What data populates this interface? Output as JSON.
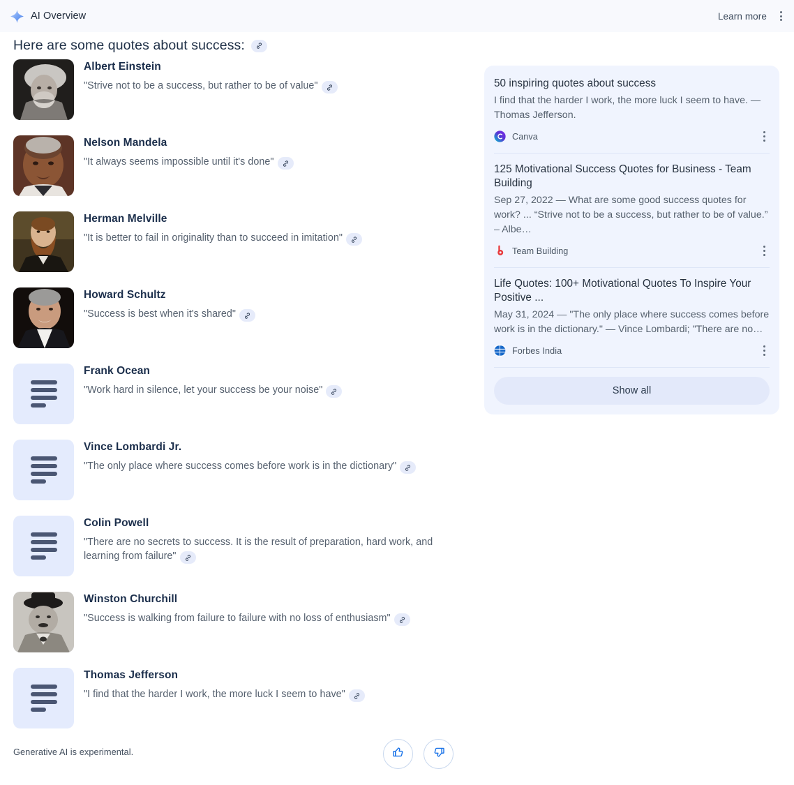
{
  "header": {
    "icon": "sparkle-icon",
    "title": "AI Overview",
    "learn_more": "Learn more",
    "menu_icon": "kebab-menu-icon"
  },
  "main": {
    "intro": "Here are some quotes about success:",
    "intro_link_icon": "link-chip-icon",
    "quotes": [
      {
        "name": "Albert Einstein",
        "quote": "\"Strive not to be a success, but rather to be of value\"",
        "thumb": "photo"
      },
      {
        "name": "Nelson Mandela",
        "quote": "\"It always seems impossible until it's done\"",
        "thumb": "photo"
      },
      {
        "name": "Herman Melville",
        "quote": "\"It is better to fail in originality than to succeed in imitation\"",
        "thumb": "photo"
      },
      {
        "name": "Howard Schultz",
        "quote": "\"Success is best when it's shared\"",
        "thumb": "photo"
      },
      {
        "name": "Frank Ocean",
        "quote": "\"Work hard in silence, let your success be your noise\"",
        "thumb": "placeholder"
      },
      {
        "name": "Vince Lombardi Jr.",
        "quote": "\"The only place where success comes before work is in the dictionary\"",
        "thumb": "placeholder"
      },
      {
        "name": "Colin Powell",
        "quote": "\"There are no secrets to success. It is the result of preparation, hard work, and learning from failure\"",
        "thumb": "placeholder"
      },
      {
        "name": "Winston Churchill",
        "quote": "\"Success is walking from failure to failure with no loss of enthusiasm\"",
        "thumb": "photo"
      },
      {
        "name": "Thomas Jefferson",
        "quote": "\"I find that the harder I work, the more luck I seem to have\"",
        "thumb": "placeholder"
      }
    ]
  },
  "sources": {
    "items": [
      {
        "title": "50 inspiring quotes about success",
        "snippet": "I find that the harder I work, the more luck I seem to have. — Thomas Jefferson.",
        "site": "Canva",
        "favicon": "canva-icon"
      },
      {
        "title": "125 Motivational Success Quotes for Business - Team Building",
        "snippet": "Sep 27, 2022 — What are some good success quotes for work? ... “Strive not to be a success, but rather to be of value.” – Albe…",
        "site": "Team Building",
        "favicon": "teambuilding-icon"
      },
      {
        "title": "Life Quotes: 100+ Motivational Quotes To Inspire Your Positive ...",
        "snippet": "May 31, 2024 — \"The only place where success comes before work is in the dictionary.\" — Vince Lombardi; \"There are no…",
        "site": "Forbes India",
        "favicon": "globe-icon"
      }
    ],
    "show_all": "Show all"
  },
  "footer": {
    "note": "Generative AI is experimental.",
    "thumbs_up_icon": "thumbs-up-icon",
    "thumbs_down_icon": "thumbs-down-icon"
  },
  "colors": {
    "header_bg": "#f8f9fd",
    "card_bg": "#f0f4fe",
    "chip_bg": "#e6ebfa",
    "accent_blue": "#1a73e8",
    "name_text": "#1b2e4b",
    "body_text": "#55606e"
  }
}
